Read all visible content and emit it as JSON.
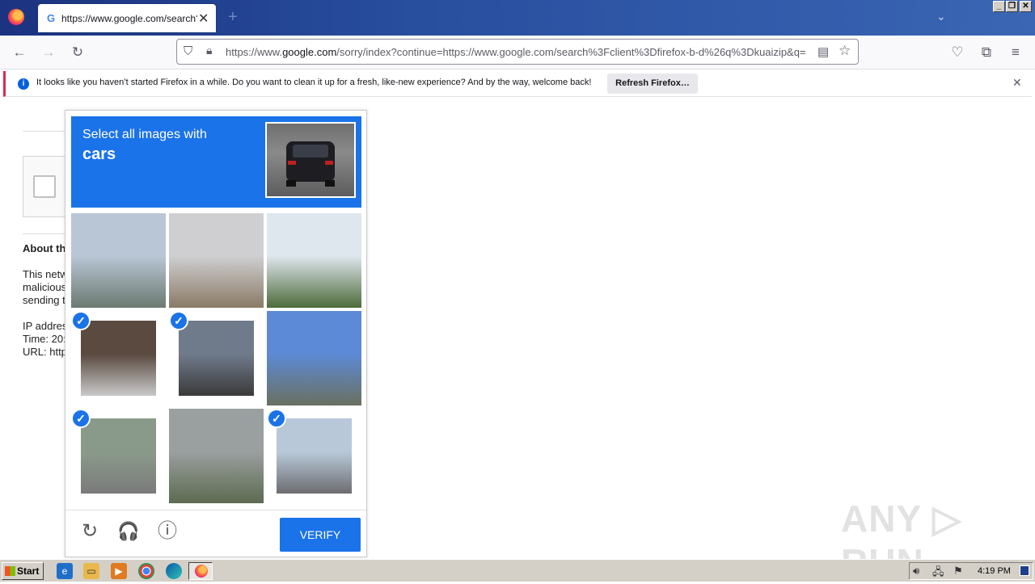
{
  "browser": {
    "tab_title": "https://www.google.com/search?c",
    "tab_favicon": "G",
    "new_tab": "+",
    "close_tab": "✕",
    "url_domain": "google.com",
    "url_prefix": "https://www.",
    "url_suffix": "/sorry/index?continue=https://www.google.com/search%3Fclient%3Dfirefox-b-d%26q%3Dkuaizip&q=",
    "win_buttons": [
      "_",
      "❐",
      "✕"
    ]
  },
  "notification": {
    "icon": "i",
    "text": "It looks like you haven’t started Firefox in a while. Do you want to clean it up for a fresh, like-new experience? And by the way, welcome back!",
    "button": "Refresh Firefox…",
    "close": "✕"
  },
  "page": {
    "about_heading": "About th",
    "body_lines": [
      "This netw",
      "malicious",
      "sending t"
    ],
    "ip_line": "IP addres",
    "time_line": "Time: 20:",
    "url_line": "URL: http"
  },
  "captcha": {
    "instruction": "Select all images with",
    "target": "cars",
    "tiles": [
      {
        "selected": false,
        "color1": "#b9c6d6",
        "color2": "#6b7a70"
      },
      {
        "selected": false,
        "color1": "#cfcfd1",
        "color2": "#8a7a66"
      },
      {
        "selected": false,
        "color1": "#dfe7ee",
        "color2": "#4d6b3a"
      },
      {
        "selected": true,
        "color1": "#5a4a40",
        "color2": "#c9c9c9"
      },
      {
        "selected": true,
        "color1": "#6f7a8a",
        "color2": "#3a3a3a"
      },
      {
        "selected": false,
        "color1": "#5c8ad6",
        "color2": "#6a7060"
      },
      {
        "selected": true,
        "color1": "#8a9a8a",
        "color2": "#7a7a7a"
      },
      {
        "selected": false,
        "color1": "#9aa0a0",
        "color2": "#5e6a50"
      },
      {
        "selected": true,
        "color1": "#b8c8d8",
        "color2": "#6c6c70"
      }
    ],
    "verify_label": "VERIFY",
    "reload_icon": "↻",
    "audio_icon": "🎧",
    "info_icon": "ⓘ"
  },
  "watermark": "ANY ▷ RUN",
  "taskbar": {
    "start_label": "Start",
    "clock": "4:19 PM"
  },
  "colors": {
    "accent": "#1a73e8",
    "notification_border": "#e22850"
  }
}
